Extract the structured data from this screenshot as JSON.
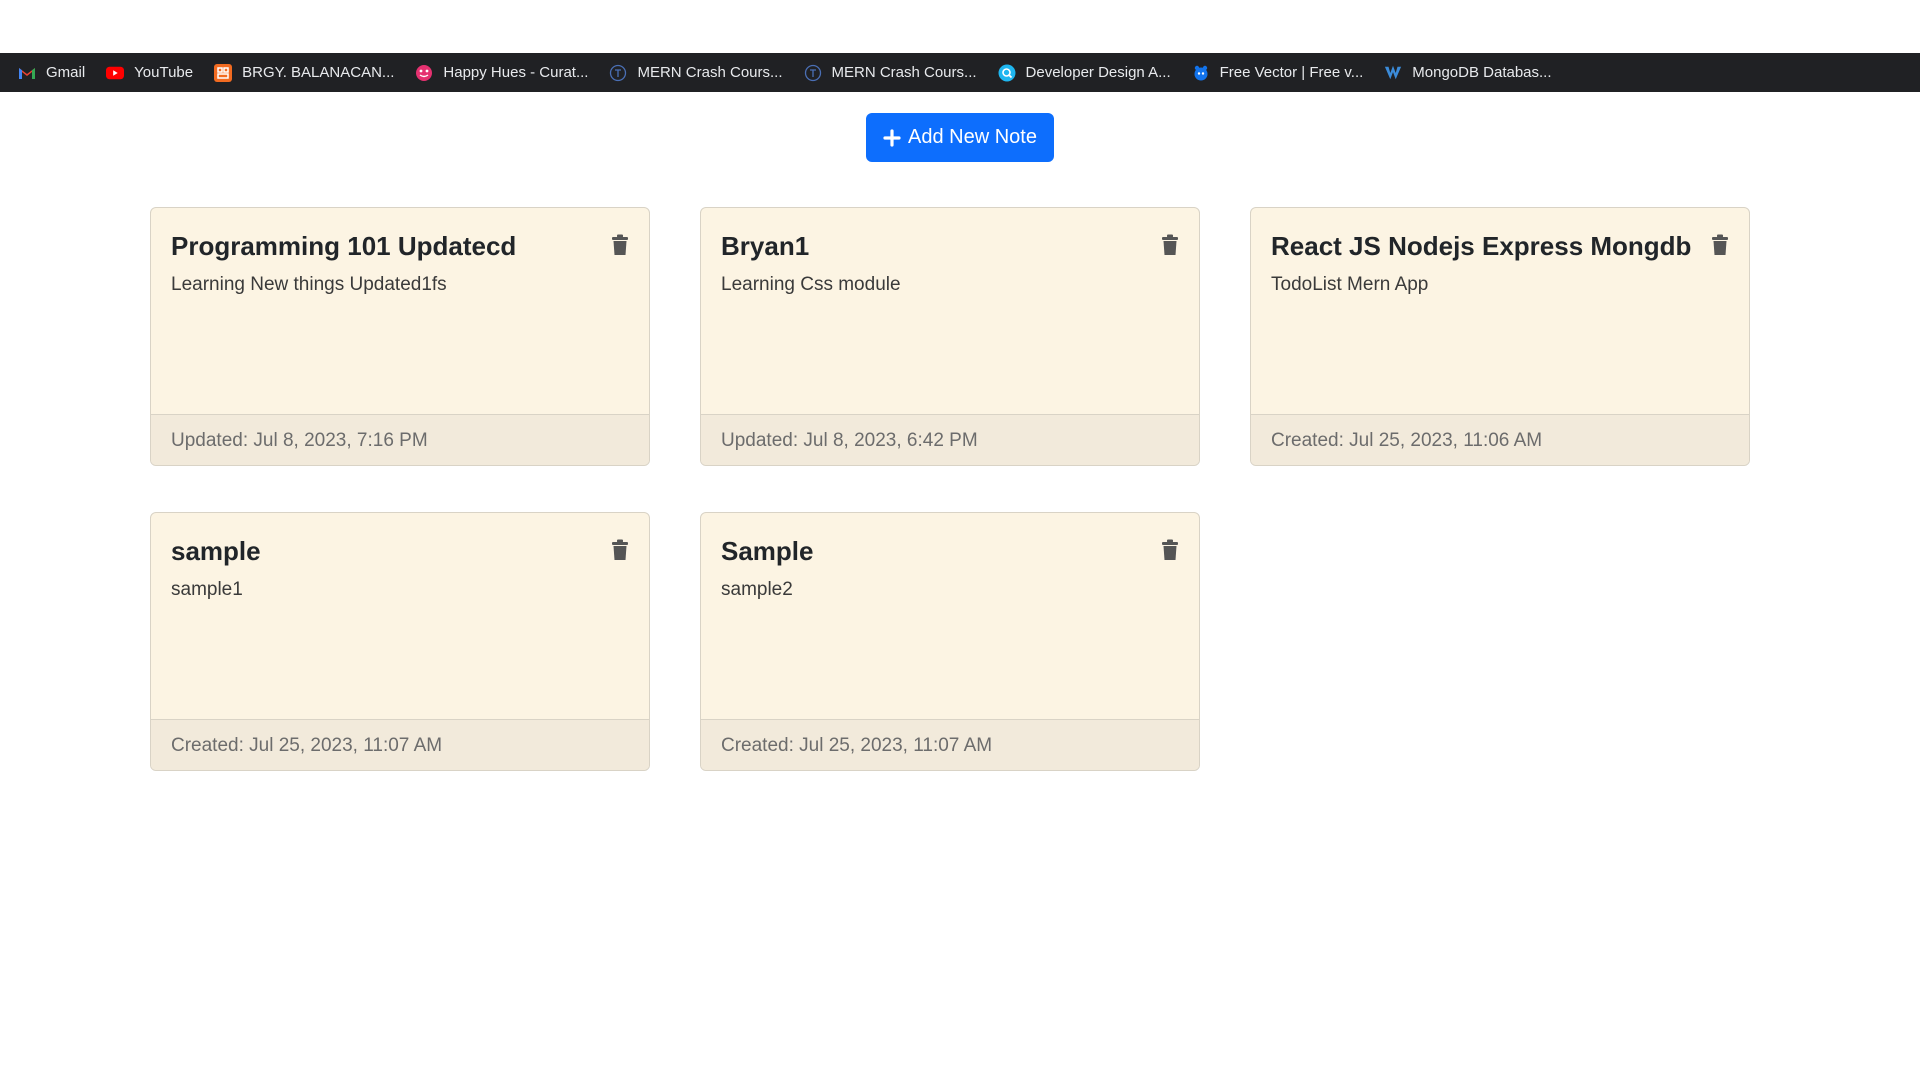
{
  "bookmarks": [
    {
      "label": "Gmail",
      "icon": "gmail-icon"
    },
    {
      "label": "YouTube",
      "icon": "youtube-icon"
    },
    {
      "label": "BRGY. BALANACAN...",
      "icon": "brgy-icon"
    },
    {
      "label": "Happy Hues - Curat...",
      "icon": "happy-hues-icon"
    },
    {
      "label": "MERN Crash Cours...",
      "icon": "mern-icon"
    },
    {
      "label": "MERN Crash Cours...",
      "icon": "mern-icon"
    },
    {
      "label": "Developer Design A...",
      "icon": "developer-design-icon"
    },
    {
      "label": "Free Vector | Free v...",
      "icon": "freepik-icon"
    },
    {
      "label": "MongoDB Databas...",
      "icon": "mongodb-icon"
    }
  ],
  "add_button": {
    "label": "Add New Note",
    "icon": "plus-icon",
    "color": "#0d6efd"
  },
  "notes": [
    {
      "title": "Programming 101 Updatecd",
      "body": "Learning New things Updated1fs",
      "footer": "Updated: Jul 8, 2023, 7:16 PM"
    },
    {
      "title": "Bryan1",
      "body": "Learning Css module",
      "footer": "Updated: Jul 8, 2023, 6:42 PM"
    },
    {
      "title": "React JS Nodejs Express Mongdb",
      "body": "TodoList Mern App",
      "footer": "Created: Jul 25, 2023, 11:06 AM"
    },
    {
      "title": "sample",
      "body": "sample1",
      "footer": "Created: Jul 25, 2023, 11:07 AM"
    },
    {
      "title": "Sample",
      "body": "sample2",
      "footer": "Created: Jul 25, 2023, 11:07 AM"
    }
  ],
  "colors": {
    "card_bg": "#fcf4e3",
    "card_footer_bg": "#f2eadb",
    "bookmarks_bar_bg": "#202124"
  }
}
